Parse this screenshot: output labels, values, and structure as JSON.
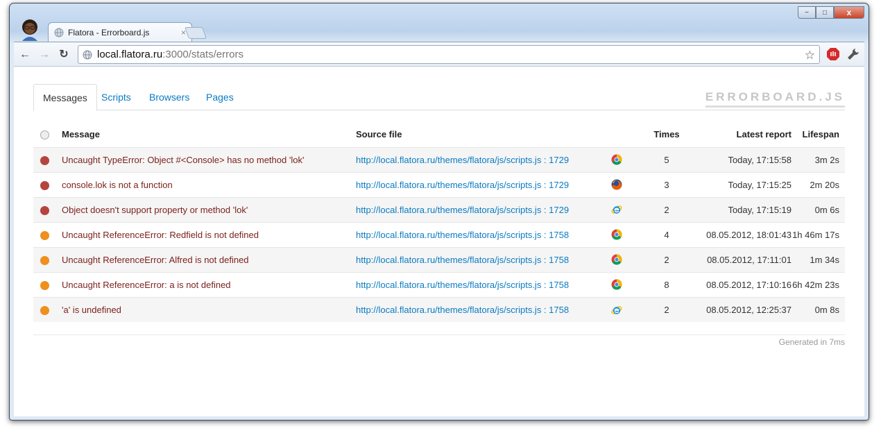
{
  "browser": {
    "tab_title": "Flatora - Errorboard.js",
    "tab_close": "×",
    "url_host": "local.flatora.ru",
    "url_path": ":3000/stats/errors",
    "window_controls": {
      "minimize": "−",
      "maximize": "□",
      "close": "x"
    },
    "nav": {
      "back": "←",
      "forward": "→",
      "reload": "↻",
      "star": "☆"
    }
  },
  "page": {
    "tabs": [
      {
        "label": "Messages",
        "active": true
      },
      {
        "label": "Scripts"
      },
      {
        "label": "Browsers"
      },
      {
        "label": "Pages"
      }
    ],
    "brand": "ERRORBOARD.JS",
    "columns": {
      "message": "Message",
      "source": "Source file",
      "times": "Times",
      "latest": "Latest report",
      "lifespan": "Lifespan"
    },
    "rows": [
      {
        "severity": "red",
        "message": "Uncaught TypeError: Object #<Console> has no method 'lok'",
        "source": "http://local.flatora.ru/themes/flatora/js/scripts.js : 1729",
        "browser": "chrome-icon",
        "times": "5",
        "latest": "Today, 17:15:58",
        "lifespan": "3m 2s"
      },
      {
        "severity": "red",
        "message": "console.lok is not a function",
        "source": "http://local.flatora.ru/themes/flatora/js/scripts.js : 1729",
        "browser": "firefox-icon",
        "times": "3",
        "latest": "Today, 17:15:25",
        "lifespan": "2m 20s"
      },
      {
        "severity": "red",
        "message": "Object doesn't support property or method 'lok'",
        "source": "http://local.flatora.ru/themes/flatora/js/scripts.js : 1729",
        "browser": "ie-icon",
        "times": "2",
        "latest": "Today, 17:15:19",
        "lifespan": "0m 6s"
      },
      {
        "severity": "orange",
        "message": "Uncaught ReferenceError: Redfield is not defined",
        "source": "http://local.flatora.ru/themes/flatora/js/scripts.js : 1758",
        "browser": "chrome-icon",
        "times": "4",
        "latest": "08.05.2012, 18:01:43",
        "lifespan": "1h 46m 17s"
      },
      {
        "severity": "orange",
        "message": "Uncaught ReferenceError: Alfred is not defined",
        "source": "http://local.flatora.ru/themes/flatora/js/scripts.js : 1758",
        "browser": "chrome-icon",
        "times": "2",
        "latest": "08.05.2012, 17:11:01",
        "lifespan": "1m 34s"
      },
      {
        "severity": "orange",
        "message": "Uncaught ReferenceError: a is not defined",
        "source": "http://local.flatora.ru/themes/flatora/js/scripts.js : 1758",
        "browser": "chrome-icon",
        "times": "8",
        "latest": "08.05.2012, 17:10:16",
        "lifespan": "6h 42m 23s"
      },
      {
        "severity": "orange",
        "message": "'a' is undefined",
        "source": "http://local.flatora.ru/themes/flatora/js/scripts.js : 1758",
        "browser": "ie-icon",
        "times": "2",
        "latest": "08.05.2012, 12:25:37",
        "lifespan": "0m 8s"
      }
    ],
    "generated": "Generated in 7ms"
  },
  "colors": {
    "severity_red": "#b5443f",
    "severity_orange": "#ef8f1c",
    "link": "#0a7bc1",
    "message": "#7a1f1a"
  }
}
